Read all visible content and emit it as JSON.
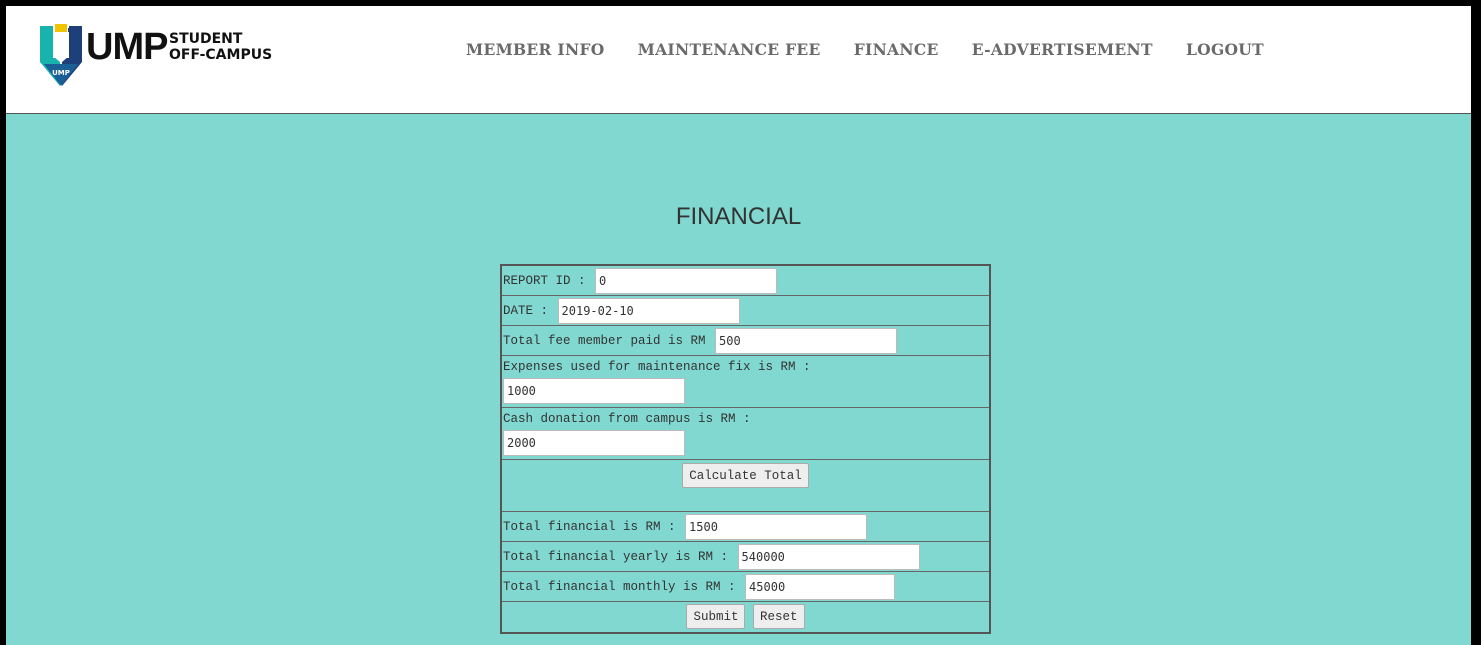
{
  "brand": {
    "logo_text": "UMP",
    "logo_badge": "UMP",
    "sub_line1": "STUDENT",
    "sub_line2": "OFF-CAMPUS"
  },
  "nav": {
    "items": [
      "MEMBER INFO",
      "MAINTENANCE FEE",
      "FINANCE",
      "E-ADVERTISEMENT",
      "LOGOUT"
    ]
  },
  "page": {
    "title": "FINANCIAL"
  },
  "form": {
    "report_id_label": "REPORT ID : ",
    "report_id_value": "0",
    "date_label": "DATE : ",
    "date_value": "2019-02-10",
    "fee_label": "Total fee member paid is RM ",
    "fee_value": "500",
    "expenses_label": "Expenses used for maintenance fix is RM :",
    "expenses_value": "1000",
    "donation_label": "Cash donation from campus is RM :",
    "donation_value": "2000",
    "calculate_label": "Calculate Total",
    "total_label": "Total financial is RM : ",
    "total_value": "1500",
    "yearly_label": "Total financial yearly is RM : ",
    "yearly_value": "540000",
    "monthly_label": "Total financial monthly is RM : ",
    "monthly_value": "45000",
    "submit_label": "Submit",
    "reset_label": "Reset"
  },
  "colors": {
    "background": "#80d8d0",
    "header": "#ffffff",
    "nav_text": "#6a6a6a",
    "logo_teal": "#1aa6a6",
    "logo_navy": "#1f3f7a"
  }
}
